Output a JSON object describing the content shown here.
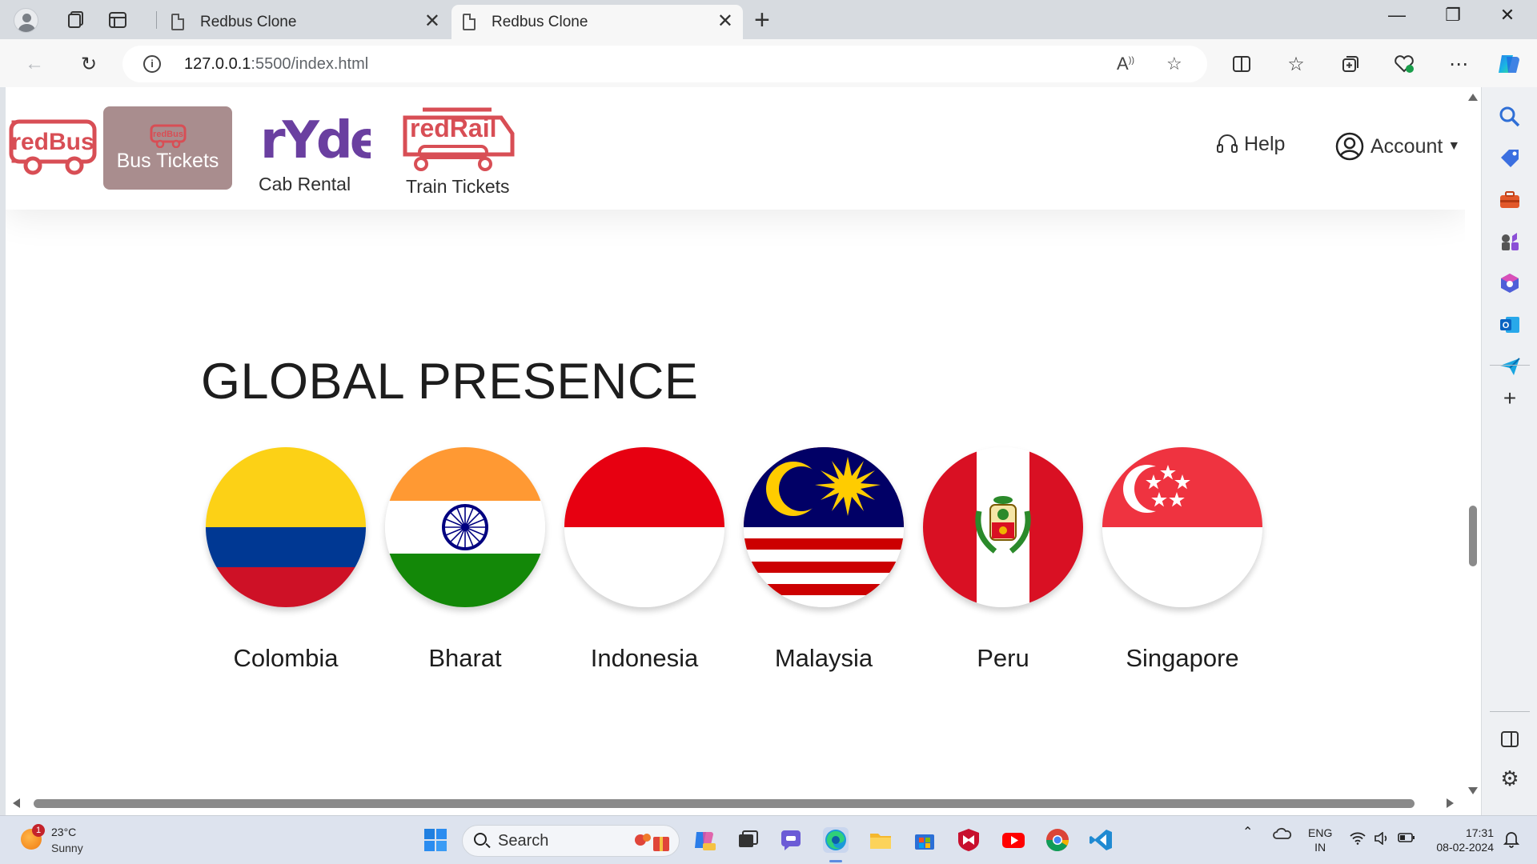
{
  "browser": {
    "tabs": [
      {
        "label": "Redbus Clone",
        "active": false
      },
      {
        "label": "Redbus Clone",
        "active": true
      }
    ],
    "url_host": "127.0.0.1",
    "url_path": ":5500/index.html"
  },
  "navbar": {
    "logo_text": "redBus",
    "items": [
      {
        "label": "Bus Tickets",
        "active": true
      },
      {
        "label": "Cab Rental",
        "brand": "rYde"
      },
      {
        "label": "Train Tickets",
        "brand": "redRail"
      }
    ],
    "help_label": "Help",
    "account_label": "Account"
  },
  "section": {
    "title": "GLOBAL PRESENCE",
    "countries": [
      {
        "name": "Colombia",
        "flag": "colombia-flag"
      },
      {
        "name": "Bharat",
        "flag": "india-flag"
      },
      {
        "name": "Indonesia",
        "flag": "indonesia-flag"
      },
      {
        "name": "Malaysia",
        "flag": "malaysia-flag"
      },
      {
        "name": "Peru",
        "flag": "peru-flag"
      },
      {
        "name": "Singapore",
        "flag": "singapore-flag"
      }
    ]
  },
  "taskbar": {
    "weather_temp": "23°C",
    "weather_desc": "Sunny",
    "weather_badge": "1",
    "search_label": "Search",
    "lang_line1": "ENG",
    "lang_line2": "IN",
    "time": "17:31",
    "date": "08-02-2024"
  },
  "colors": {
    "brand_red": "#d84e55",
    "bus_tab_bg": "#a98d8e",
    "ryde_purple": "#6a3fa0"
  }
}
